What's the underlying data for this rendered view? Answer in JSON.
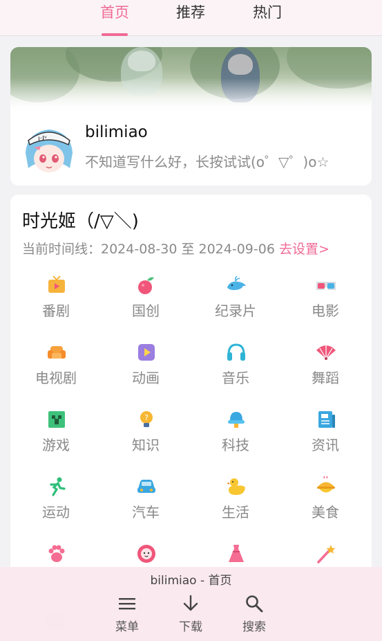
{
  "tabs": [
    {
      "label": "首页",
      "active": true
    },
    {
      "label": "推荐",
      "active": false
    },
    {
      "label": "热门",
      "active": false
    }
  ],
  "profile": {
    "username": "bilimiao",
    "bio": "不知道写什么好，长按试试(o゜▽゜)o☆"
  },
  "timeline": {
    "title": "时光姬（/▽＼)",
    "label": "当前时间线：2024-08-30 至 2024-09-06",
    "link": "去设置>"
  },
  "categories": [
    {
      "label": "番剧",
      "icon": "tv-icon"
    },
    {
      "label": "国创",
      "icon": "fruit-icon"
    },
    {
      "label": "纪录片",
      "icon": "whale-icon"
    },
    {
      "label": "电影",
      "icon": "3d-glasses-icon"
    },
    {
      "label": "电视剧",
      "icon": "sofa-icon"
    },
    {
      "label": "动画",
      "icon": "play-icon"
    },
    {
      "label": "音乐",
      "icon": "headphones-icon"
    },
    {
      "label": "舞蹈",
      "icon": "fan-icon"
    },
    {
      "label": "游戏",
      "icon": "creeper-icon"
    },
    {
      "label": "知识",
      "icon": "lightbulb-icon"
    },
    {
      "label": "科技",
      "icon": "satellite-icon"
    },
    {
      "label": "资讯",
      "icon": "news-icon"
    },
    {
      "label": "运动",
      "icon": "runner-icon"
    },
    {
      "label": "汽车",
      "icon": "car-icon"
    },
    {
      "label": "生活",
      "icon": "duck-icon"
    },
    {
      "label": "美食",
      "icon": "food-icon"
    },
    {
      "label": "",
      "icon": "paw-icon"
    },
    {
      "label": "",
      "icon": "lion-icon"
    },
    {
      "label": "",
      "icon": "dress-icon"
    },
    {
      "label": "",
      "icon": "magic-wand-icon"
    }
  ],
  "bottom": {
    "title": "bilimiao - 首页",
    "buttons": [
      {
        "label": "菜单",
        "icon": "menu-icon"
      },
      {
        "label": "下载",
        "icon": "download-icon"
      },
      {
        "label": "搜索",
        "icon": "search-icon"
      }
    ]
  },
  "colors": {
    "accent": "#f06a95",
    "topbar_bg": "#fbf3f6",
    "bottombar_bg": "#fae8ee"
  }
}
